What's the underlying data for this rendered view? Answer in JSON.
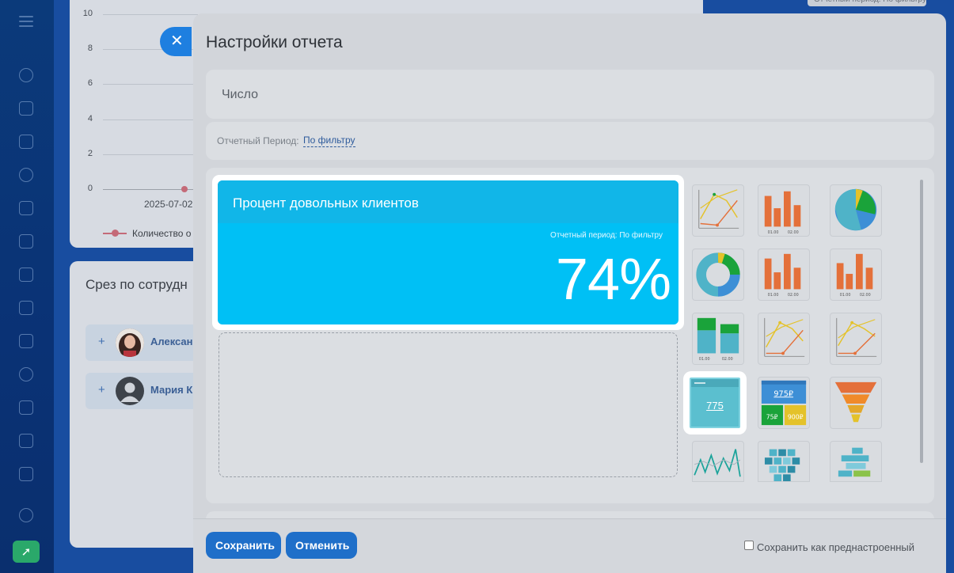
{
  "background": {
    "y_ticks": [
      "10",
      "8",
      "6",
      "4",
      "2",
      "0"
    ],
    "date_label": "2025-07-02",
    "legend_label": "Количество о",
    "slice_title": "Срез по сотрудн",
    "employees": [
      "Алексан",
      "Мария К"
    ],
    "top_filter": "Отчетный период: По фильтру"
  },
  "modal": {
    "title": "Настройки отчета",
    "name_value": "Число",
    "period_label": "Отчетный Период:",
    "period_value": "По фильтру"
  },
  "preview": {
    "title": "Процент довольных клиентов",
    "period": "Отчетный период: По фильтру",
    "value": "74%"
  },
  "thumbs": {
    "selected_number": "775",
    "numeric_big": "975₽",
    "numeric_small_a": "75₽",
    "numeric_small_b": "900₽",
    "bar_label_a": "01.00",
    "bar_label_b": "02.00"
  },
  "footer": {
    "save_label": "Сохранить",
    "cancel_label": "Отменить",
    "preset_label": "Сохранить как преднастроенный"
  },
  "colors": {
    "preview_bg": "#00c0f5",
    "button_blue": "#1f6fc9",
    "orange": "#e4703a",
    "green": "#1aa33a",
    "teal": "#4fb3c8"
  }
}
